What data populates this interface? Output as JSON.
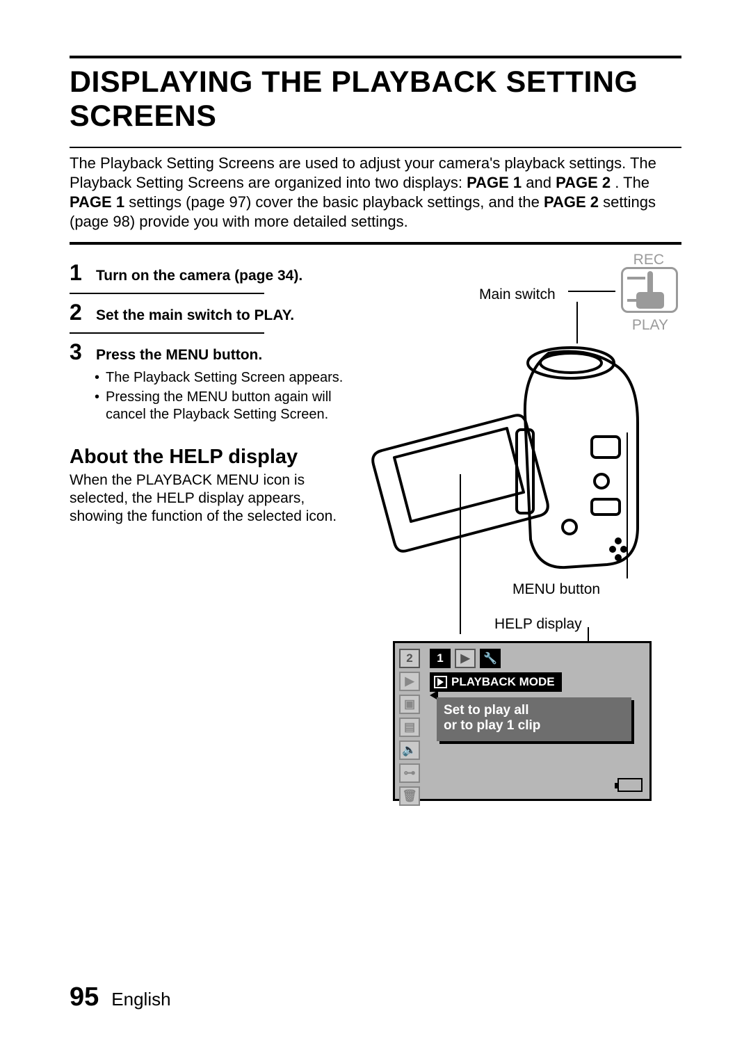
{
  "title": "DISPLAYING THE PLAYBACK SETTING SCREENS",
  "intro": {
    "t1": "The Playback Setting Screens are used to adjust your camera's playback settings. The Playback Setting Screens are organized into two displays: ",
    "b1": "PAGE 1",
    "t2": " and ",
    "b2": "PAGE 2",
    "t3": ". The ",
    "b3": "PAGE 1",
    "t4": " settings (page 97) cover the basic playback settings, and the ",
    "b4": "PAGE 2",
    "t5": " settings (page 98) provide you with more detailed settings."
  },
  "steps": [
    {
      "num": "1",
      "head": "Turn on the camera (page 34)."
    },
    {
      "num": "2",
      "head": "Set the main switch to PLAY."
    },
    {
      "num": "3",
      "head": "Press the MENU button.",
      "bullets": [
        "The Playback Setting Screen appears.",
        "Pressing the MENU button again will cancel the Playback Setting Screen."
      ]
    }
  ],
  "help": {
    "heading": "About the HELP display",
    "body": "When the PLAYBACK MENU icon is selected, the HELP display appears, showing the function of the selected icon."
  },
  "labels": {
    "rec": "REC",
    "play": "PLAY",
    "main_switch": "Main switch",
    "menu_button": "MENU button",
    "help_display": "HELP display"
  },
  "screen": {
    "tab2": "2",
    "tab1": "1",
    "mode_label": "PLAYBACK MODE",
    "help_line1": "Set to play all",
    "help_line2": "or to play 1 clip"
  },
  "footer": {
    "page": "95",
    "lang": "English"
  }
}
